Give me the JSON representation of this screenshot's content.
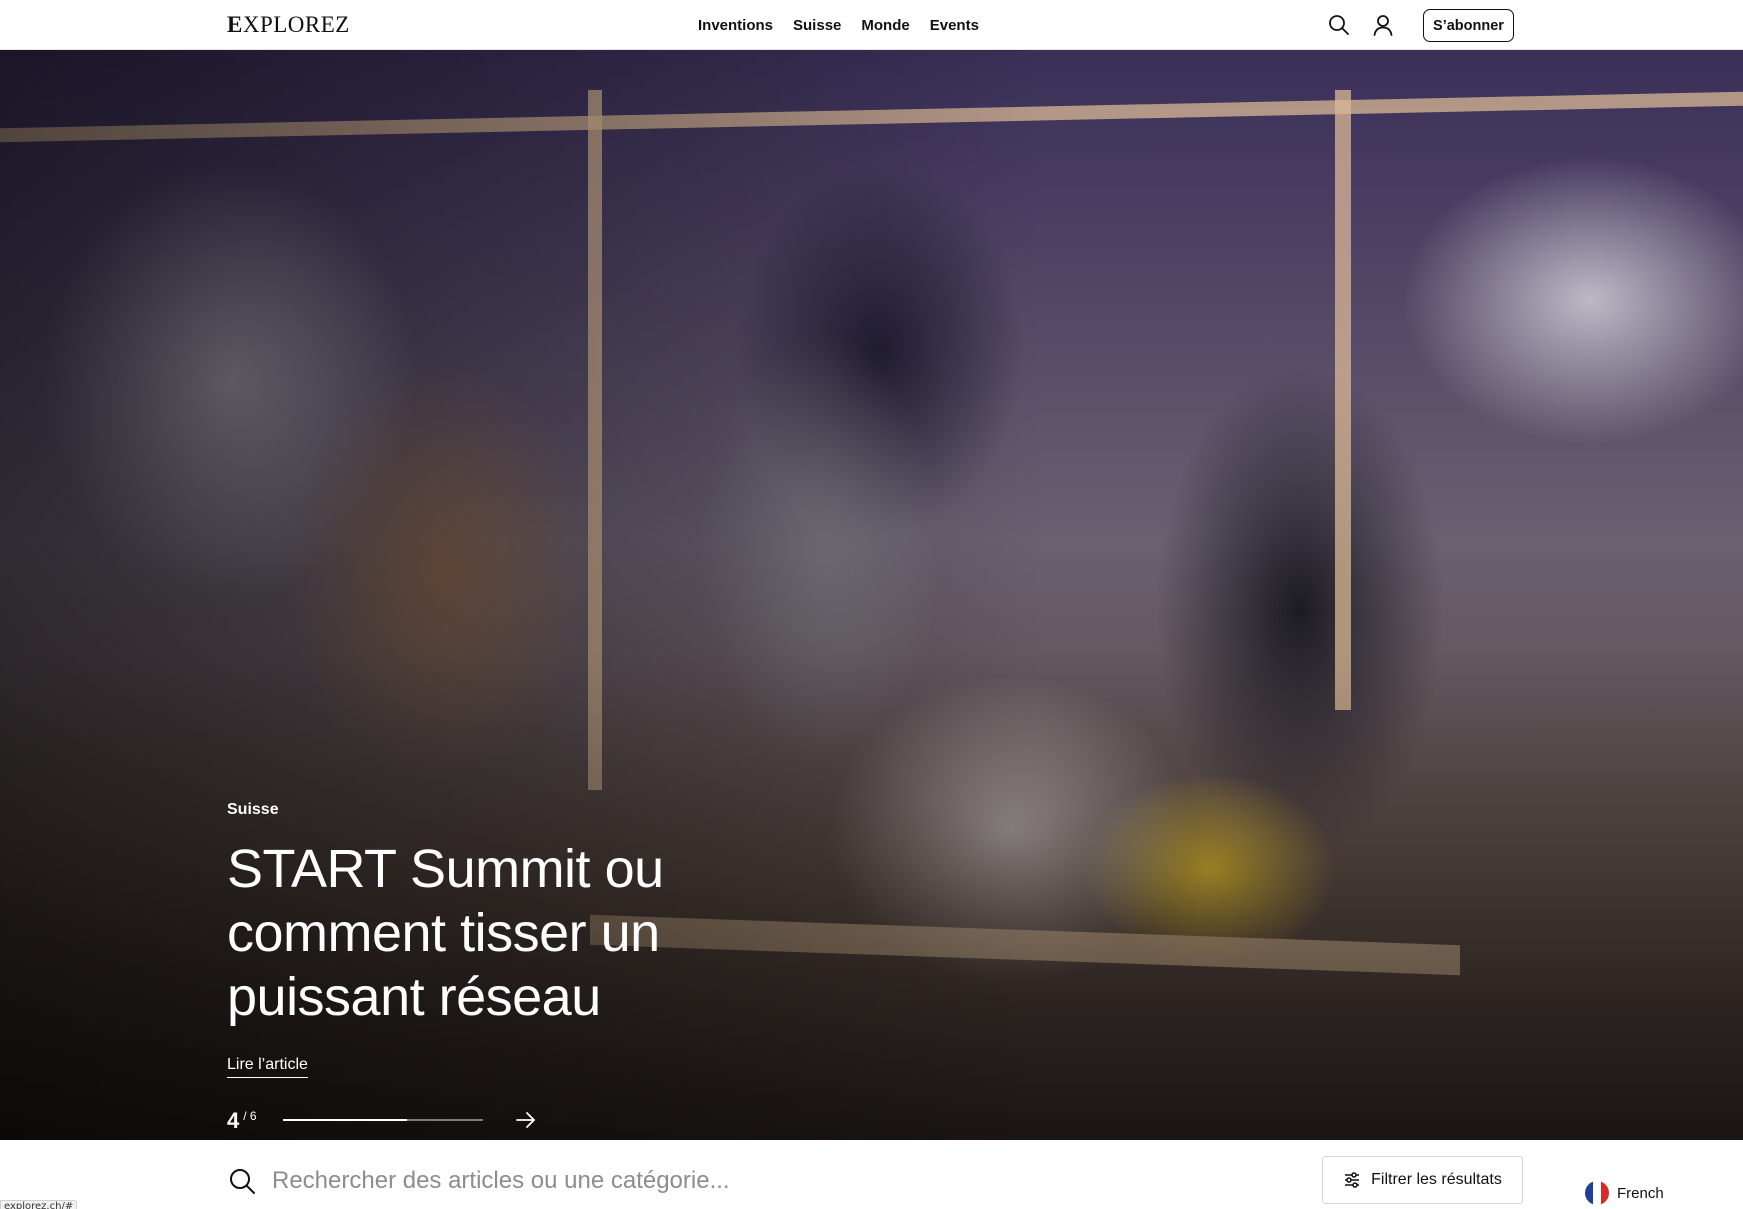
{
  "header": {
    "logo_first": "E",
    "logo_rest": "XPLOREZ",
    "nav": [
      "Inventions",
      "Suisse",
      "Monde",
      "Events"
    ],
    "subscribe_label": "S’abonner",
    "icons": [
      "search-icon",
      "user-icon"
    ]
  },
  "hero": {
    "category": "Suisse",
    "title": "START Summit ou comment tisser un puissant réseau",
    "link_label": "Lire l’article",
    "slide_current": "4",
    "slide_total": "/ 6",
    "progress": 0.62
  },
  "search": {
    "placeholder": "Rechercher des articles ou une catégorie...",
    "filter_label": "Filtrer les résultats",
    "language_label": "French"
  },
  "status_bar": {
    "url": "explorez.ch/#"
  },
  "colors": {
    "accent": "#111111",
    "hero_text": "#ffffff",
    "placeholder": "#8d8d8d"
  }
}
